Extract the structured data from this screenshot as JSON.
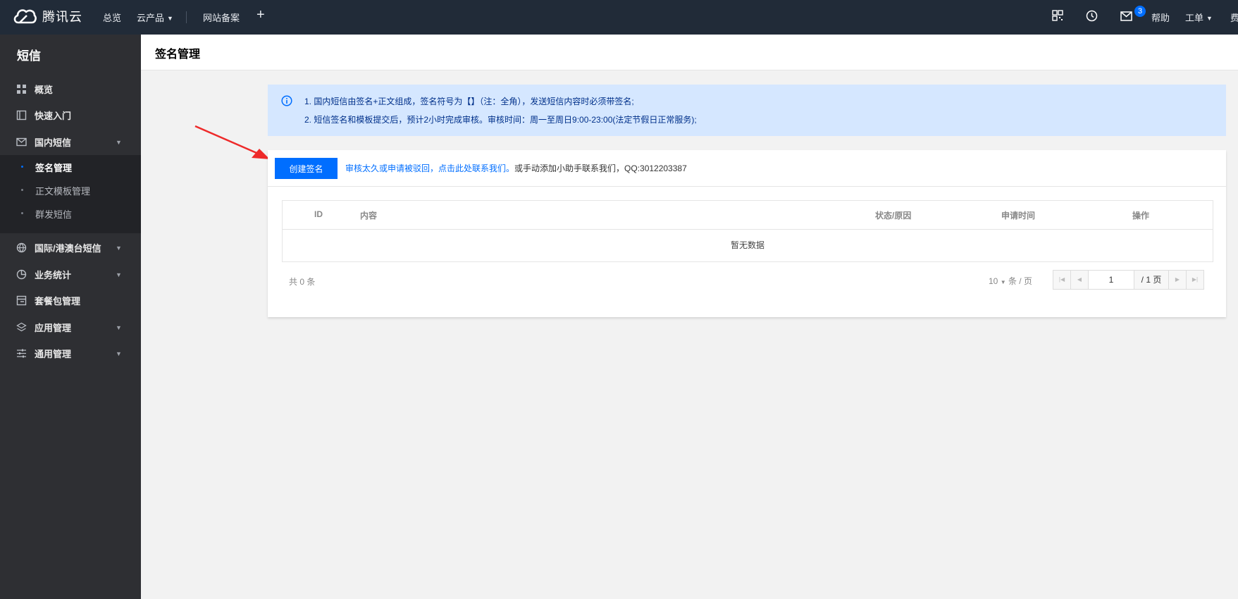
{
  "topbar": {
    "brand": "腾讯云",
    "nav": [
      "总览",
      "云产品",
      "网站备案"
    ],
    "mail_badge": "3",
    "help": "帮助",
    "ticket": "工单",
    "fee": "费"
  },
  "sidebar": {
    "title": "短信",
    "items": [
      {
        "label": "概览",
        "icon": "grid-icon"
      },
      {
        "label": "快速入门",
        "icon": "book-icon"
      },
      {
        "label": "国内短信",
        "icon": "mail-icon"
      },
      {
        "label": "国际/港澳台短信",
        "icon": "globe-icon"
      },
      {
        "label": "业务统计",
        "icon": "pie-chart-icon"
      },
      {
        "label": "套餐包管理",
        "icon": "package-icon"
      },
      {
        "label": "应用管理",
        "icon": "layers-icon"
      },
      {
        "label": "通用管理",
        "icon": "sliders-icon"
      }
    ],
    "subitems": [
      "签名管理",
      "正文模板管理",
      "群发短信"
    ]
  },
  "header": {
    "title": "签名管理"
  },
  "notice": {
    "line1": "1. 国内短信由签名+正文组成，签名符号为【】（注：全角），发送短信内容时必须带签名;",
    "line2": "2. 短信签名和模板提交后，预计2小时完成审核。审核时间：周一至周日9:00-23:00(法定节假日正常服务);"
  },
  "toolbar": {
    "create_label": "创建签名",
    "tip_link": "审核太久或申请被驳回，点击此处联系我们。",
    "tip_text": "或手动添加小助手联系我们，QQ:3012203387"
  },
  "table": {
    "columns": [
      "ID",
      "内容",
      "状态/原因",
      "申请时间",
      "操作"
    ],
    "empty": "暂无数据"
  },
  "pagination": {
    "total": "共 0 条",
    "page_size": "10",
    "page_size_unit": "条 / 页",
    "current": "1",
    "total_pages": "/ 1 页"
  },
  "colors": {
    "topbar": "#212b38",
    "sidebar": "#2e2f33",
    "accent": "#006eff",
    "notice_bg": "#d5e7ff",
    "arrow": "#ee2a2a"
  }
}
